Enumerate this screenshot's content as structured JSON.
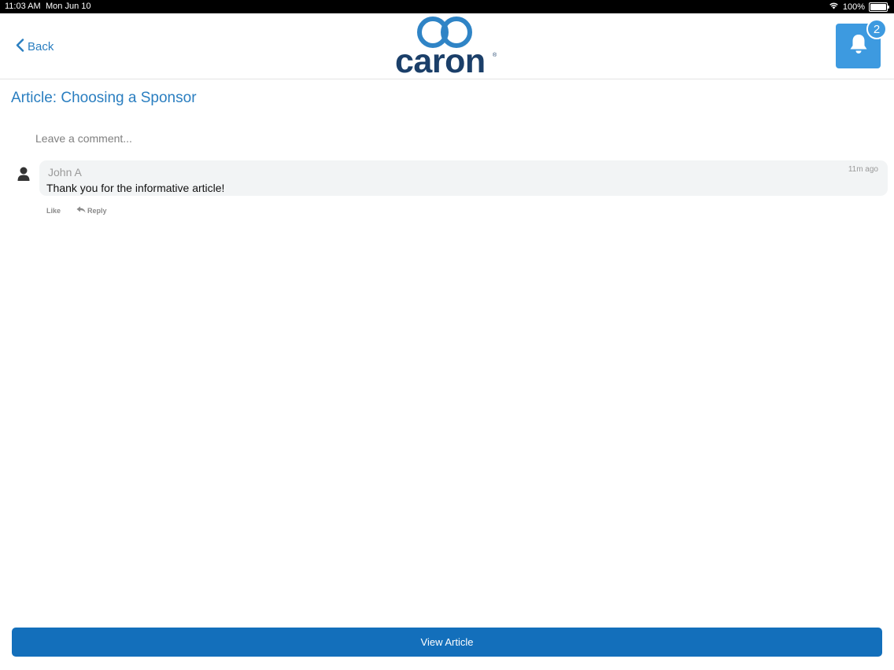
{
  "status_bar": {
    "time": "11:03 AM",
    "date": "Mon Jun 10",
    "battery": "100%",
    "battery_level": 1.0
  },
  "header": {
    "back_label": "Back",
    "logo_text": "caron",
    "logo_reg": "®",
    "notification_count": "2"
  },
  "article": {
    "title": "Article: Choosing a Sponsor"
  },
  "comment_box": {
    "placeholder": "Leave a comment...",
    "value": ""
  },
  "comments": [
    {
      "author": "John A",
      "time": "11m ago",
      "text": "Thank you for the informative article!",
      "like_label": "Like",
      "reply_label": "Reply"
    }
  ],
  "footer": {
    "view_article_label": "View Article"
  },
  "colors": {
    "accent": "#2a7ec0",
    "bell_bg": "#3d9ae0",
    "button_bg": "#136fbb",
    "logo_navy": "#1b3f69"
  },
  "icons": {
    "back": "chevron-left-icon",
    "bell": "bell-icon",
    "avatar": "user-silhouette-icon",
    "reply": "reply-arrow-icon",
    "wifi": "wifi-icon",
    "battery": "battery-icon"
  }
}
